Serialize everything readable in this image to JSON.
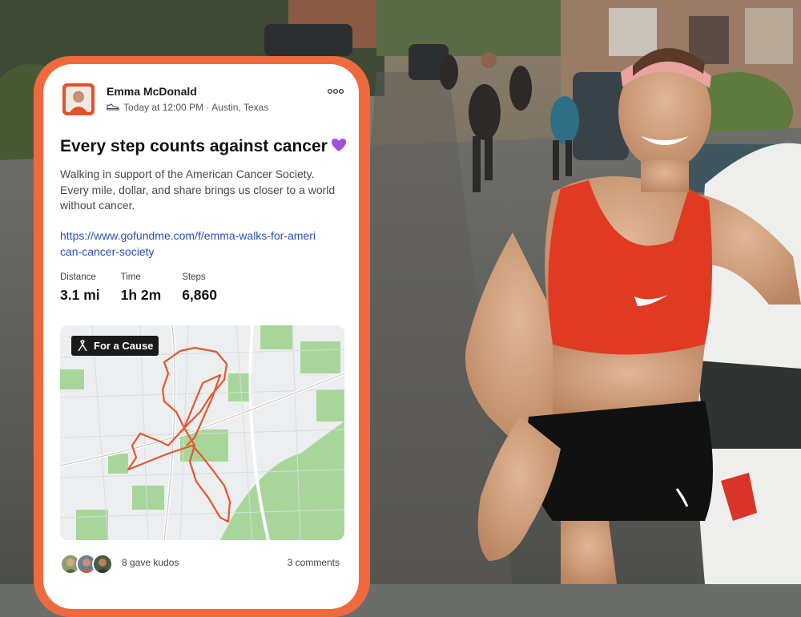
{
  "post": {
    "author_name": "Emma McDonald",
    "meta": "Today at 12:00 PM · Austin, Texas",
    "more_icon": "more-horizontal-icon",
    "title": "Every step counts against cancer",
    "title_emoji": "purple-heart-icon",
    "description": "Walking in support of the American Cancer Society. Every mile, dollar, and share brings us closer to a world without cancer.",
    "link": "https://www.gofundme.com/f/emma-walks-for-american-cancer-society"
  },
  "stats": [
    {
      "label": "Distance",
      "value": "3.1 mi"
    },
    {
      "label": "Time",
      "value": "1h 2m"
    },
    {
      "label": "Steps",
      "value": "6,860"
    }
  ],
  "map": {
    "badge_label": "For a Cause",
    "badge_icon": "ribbon-cause-icon",
    "route_color": "#e4572e"
  },
  "footer": {
    "kudos_label": "8 gave kudos",
    "comments_label": "3 comments"
  },
  "colors": {
    "accent_orange": "#ee6a3e",
    "link_blue": "#2a4fbf"
  }
}
